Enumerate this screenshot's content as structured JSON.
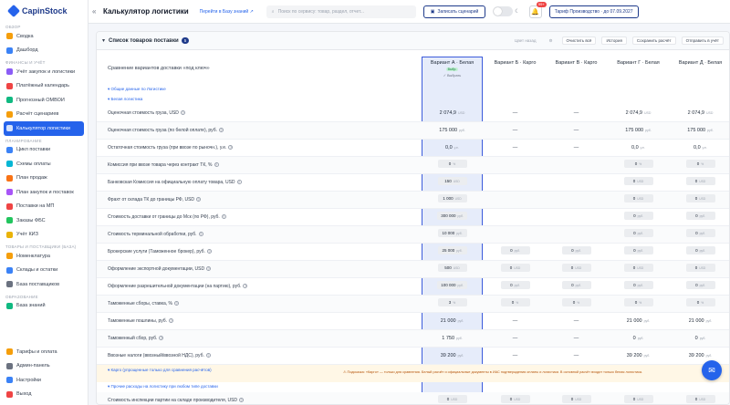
{
  "app": {
    "name": "CapinStock"
  },
  "topbar": {
    "title": "Калькулятор логистики",
    "kb_link": "Перейти в Базу знаний ↗",
    "search_placeholder": "Поиск по сервису: товар, раздел, отчет...",
    "record_button": "Записать сценарий",
    "notifications_count": "99+",
    "tariff": "Тариф Производство · до 07.09.2027"
  },
  "sidebar": {
    "sections": [
      {
        "title": "ОБЗОР",
        "items": [
          {
            "label": "Сводка",
            "color": "#f59e0b"
          },
          {
            "label": "Дашборд",
            "color": "#3b82f6"
          }
        ]
      },
      {
        "title": "ФИНАНСЫ И УЧЁТ",
        "items": [
          {
            "label": "Учёт закупок и логистики",
            "color": "#8b5cf6"
          },
          {
            "label": "Платёжный календарь",
            "color": "#ef4444"
          },
          {
            "label": "Прогнозный ОМВОИ",
            "color": "#10b981"
          },
          {
            "label": "Расчёт сценариев",
            "color": "#f59e0b"
          },
          {
            "label": "Калькулятор логистики",
            "color": "#ffffff",
            "active": true
          }
        ]
      },
      {
        "title": "ПЛАНИРОВАНИЕ",
        "items": [
          {
            "label": "Цикл поставки",
            "color": "#3b82f6"
          },
          {
            "label": "Схемы оплаты",
            "color": "#06b6d4"
          },
          {
            "label": "План продаж",
            "color": "#f97316"
          },
          {
            "label": "План закупок и поставок",
            "color": "#a855f7"
          },
          {
            "label": "Поставки на МП",
            "color": "#ef4444"
          },
          {
            "label": "Заказы ФБС",
            "color": "#22c55e"
          },
          {
            "label": "Учёт КИЗ",
            "color": "#eab308"
          }
        ]
      },
      {
        "title": "ТОВАРЫ И ПОСТАВЩИКИ (БАЗА)",
        "items": [
          {
            "label": "Номенклатура",
            "color": "#f59e0b"
          },
          {
            "label": "Склады и остатки",
            "color": "#3b82f6"
          },
          {
            "label": "База поставщиков",
            "color": "#6b7280"
          }
        ]
      },
      {
        "title": "ОБРАЗОВАНИЕ",
        "items": [
          {
            "label": "База знаний",
            "color": "#10b981"
          }
        ]
      }
    ],
    "bottom": [
      {
        "label": "Тарифы и оплата",
        "color": "#f59e0b"
      },
      {
        "label": "Админ-панель",
        "color": "#6b7280"
      },
      {
        "label": "Настройки",
        "color": "#3b82f6"
      },
      {
        "label": "Выход",
        "color": "#ef4444"
      }
    ]
  },
  "panel": {
    "title": "Список товаров поставки",
    "count": "5",
    "tools": {
      "grid_view": "Цвет назад",
      "clear": "Очистить всё",
      "history": "История",
      "save": "Сохранить расчёт",
      "send": "Отправить в учёт"
    }
  },
  "table": {
    "header_label": "Сравнение вариантов доставки «под ключ»",
    "variants": [
      {
        "name": "Вариант А · Белая",
        "tag": "Выбр.",
        "selected_label": "✓ Выбрать"
      },
      {
        "name": "Вариант Б · Карго"
      },
      {
        "name": "Вариант В · Карго"
      },
      {
        "name": "Вариант Г · Белая"
      },
      {
        "name": "Вариант Д · Белая"
      }
    ],
    "rows": [
      {
        "type": "section",
        "label": "▾ Общие данные по Логистике"
      },
      {
        "type": "section",
        "label": "▾ Белая логистика"
      },
      {
        "label": "Оценочная стоимость груза, USD",
        "q": true,
        "style": "plain",
        "cells": [
          "2 074,9|USD",
          "—",
          "—",
          "2 074,9|USD",
          "2 074,9|USD"
        ]
      },
      {
        "label": "Оценочная стоимость груза (по белой оплате), руб.",
        "q": true,
        "style": "plain",
        "cells": [
          "175 000|руб.",
          "—",
          "—",
          "175 000|руб.",
          "175 000|руб."
        ]
      },
      {
        "label": "Остаточная стоимость груза (при ввозе по рыночн.), у.е.",
        "q": true,
        "style": "plain",
        "cells": [
          "0,0|у.е.",
          "—",
          "—",
          "0,0|у.е.",
          "0,0|у.е."
        ]
      },
      {
        "label": "Комиссия при ввозе товара через контракт ТК, %",
        "q": true,
        "style": "pill",
        "cells": [
          "0|%",
          "",
          "",
          "0|%",
          "0|%"
        ]
      },
      {
        "label": "Банковская Комиссия на официальную оплату товара, USD",
        "q": true,
        "style": "pill",
        "cells": [
          "150|USD",
          "",
          "",
          "0|USD",
          "0|USD"
        ]
      },
      {
        "label": "Фрахт от склада ТК до границы РФ, USD",
        "q": true,
        "style": "pill",
        "cells": [
          "1 000|USD",
          "",
          "",
          "0|USD",
          "0|USD"
        ]
      },
      {
        "label": "Стоимость доставки от границы до Мск (по РФ), руб.",
        "q": true,
        "style": "pill",
        "cells": [
          "300 000|руб.",
          "",
          "",
          "0|руб.",
          "0|руб."
        ]
      },
      {
        "label": "Стоимость терминальной обработки, руб.",
        "q": true,
        "style": "pill",
        "cells": [
          "10 000|руб.",
          "",
          "",
          "0|руб.",
          "0|руб."
        ]
      },
      {
        "label": "Брокерские услуги (Таможенное брокер), руб.",
        "q": true,
        "style": "pill",
        "cells": [
          "25 000|руб.",
          "0|руб.",
          "0|руб.",
          "0|руб.",
          "0|руб."
        ]
      },
      {
        "label": "Оформление экспортной документации, USD",
        "q": true,
        "style": "pill",
        "cells": [
          "500|USD",
          "0|USD",
          "0|USD",
          "0|USD",
          "0|USD"
        ]
      },
      {
        "label": "Оформление разрешительной документации (на партию), руб.",
        "q": true,
        "style": "pill",
        "cells": [
          "100 000|руб.",
          "0|руб.",
          "0|руб.",
          "0|руб.",
          "0|руб."
        ]
      },
      {
        "label": "Таможенные сборы, ставка, %",
        "q": true,
        "style": "pill",
        "cells": [
          "3|%",
          "0|%",
          "0|%",
          "0|%",
          "0|%"
        ]
      },
      {
        "label": "Таможенные пошлины, руб.",
        "q": true,
        "style": "plain",
        "cells": [
          "21 000|руб.",
          "—",
          "—",
          "21 000|руб.",
          "21 000|руб."
        ]
      },
      {
        "label": "Таможенный сбор, руб.",
        "q": true,
        "style": "plain",
        "cells": [
          "1 750|руб.",
          "—",
          "—",
          "0|руб.",
          "0|руб."
        ]
      },
      {
        "label": "Ввозные налоги (ввозный/ввозной НДС), руб.",
        "q": true,
        "style": "plain",
        "cells": [
          "39 200|руб.",
          "—",
          "—",
          "39 200|руб.",
          "39 200|руб."
        ]
      },
      {
        "type": "section",
        "label": "▾ Карго (упрощенные только для сравнения расчётов)",
        "warn": "⚠ Подсказка: «Карго» — только для сравнения. Белый расчёт и официальные документы в ИАС подтверждения оплаты и логистики. В основной расчёт входит только белая логистика."
      },
      {
        "type": "section",
        "label": "▾ Прочие расходы на логистику при любом типе доставки"
      },
      {
        "label": "Стоимость инспекции партии на складе производителя, USD",
        "q": true,
        "style": "pill",
        "cells": [
          "0|USD",
          "0|USD",
          "0|USD",
          "0|USD",
          "0|USD"
        ]
      }
    ]
  }
}
